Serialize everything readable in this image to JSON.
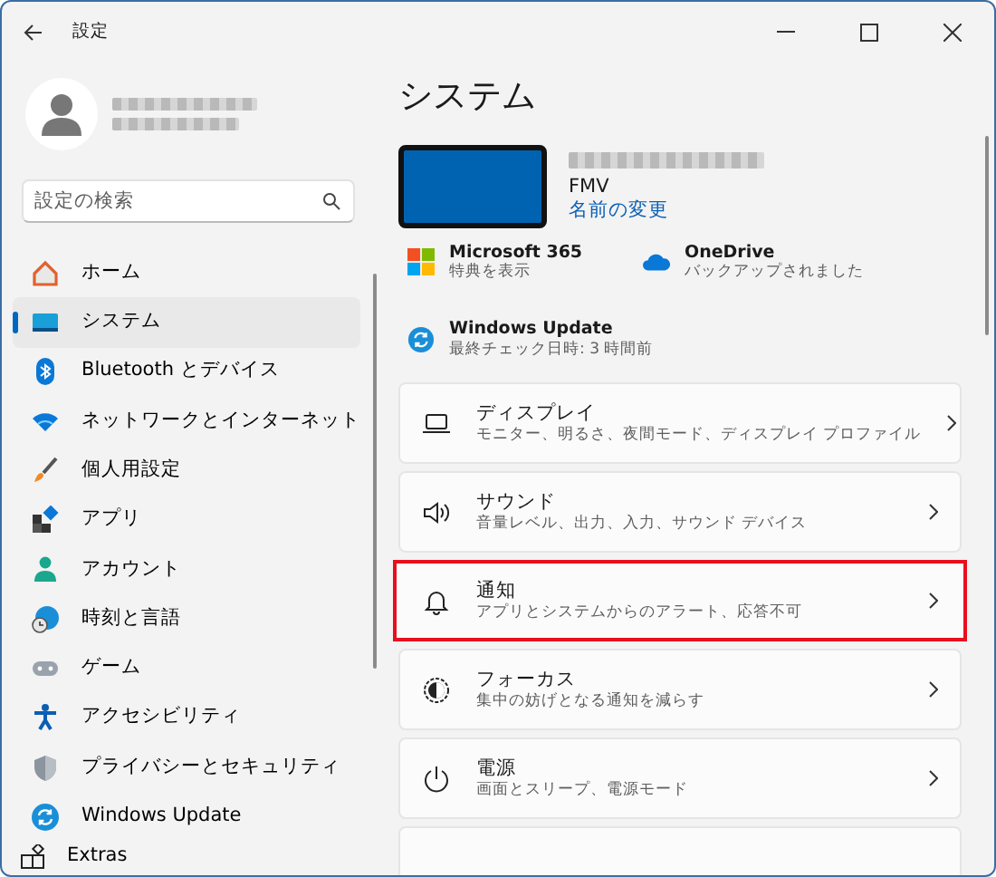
{
  "window": {
    "title": "設定"
  },
  "search": {
    "placeholder": "設定の検索"
  },
  "nav": [
    {
      "label": "ホーム",
      "selected": false
    },
    {
      "label": "システム",
      "selected": true
    },
    {
      "label": "Bluetooth とデバイス",
      "selected": false
    },
    {
      "label": "ネットワークとインターネット",
      "selected": false
    },
    {
      "label": "個人用設定",
      "selected": false
    },
    {
      "label": "アプリ",
      "selected": false
    },
    {
      "label": "アカウント",
      "selected": false
    },
    {
      "label": "時刻と言語",
      "selected": false
    },
    {
      "label": "ゲーム",
      "selected": false
    },
    {
      "label": "アクセシビリティ",
      "selected": false
    },
    {
      "label": "プライバシーとセキュリティ",
      "selected": false
    },
    {
      "label": "Windows Update",
      "selected": false
    }
  ],
  "extras": {
    "label": "Extras"
  },
  "page": {
    "title": "システム"
  },
  "device": {
    "model": "FMV",
    "rename_link": "名前の変更"
  },
  "services": [
    {
      "title": "Microsoft 365",
      "subtitle": "特典を表示"
    },
    {
      "title": "OneDrive",
      "subtitle": "バックアップされました"
    },
    {
      "title": "Windows Update",
      "subtitle": "最終チェック日時: 3 時間前"
    }
  ],
  "settings": [
    {
      "title": "ディスプレイ",
      "subtitle": "モニター、明るさ、夜間モード、ディスプレイ プロファイル",
      "highlighted": false
    },
    {
      "title": "サウンド",
      "subtitle": "音量レベル、出力、入力、サウンド デバイス",
      "highlighted": false
    },
    {
      "title": "通知",
      "subtitle": "アプリとシステムからのアラート、応答不可",
      "highlighted": true
    },
    {
      "title": "フォーカス",
      "subtitle": "集中の妨げとなる通知を減らす",
      "highlighted": false
    },
    {
      "title": "電源",
      "subtitle": "画面とスリープ、電源モード",
      "highlighted": false
    }
  ]
}
